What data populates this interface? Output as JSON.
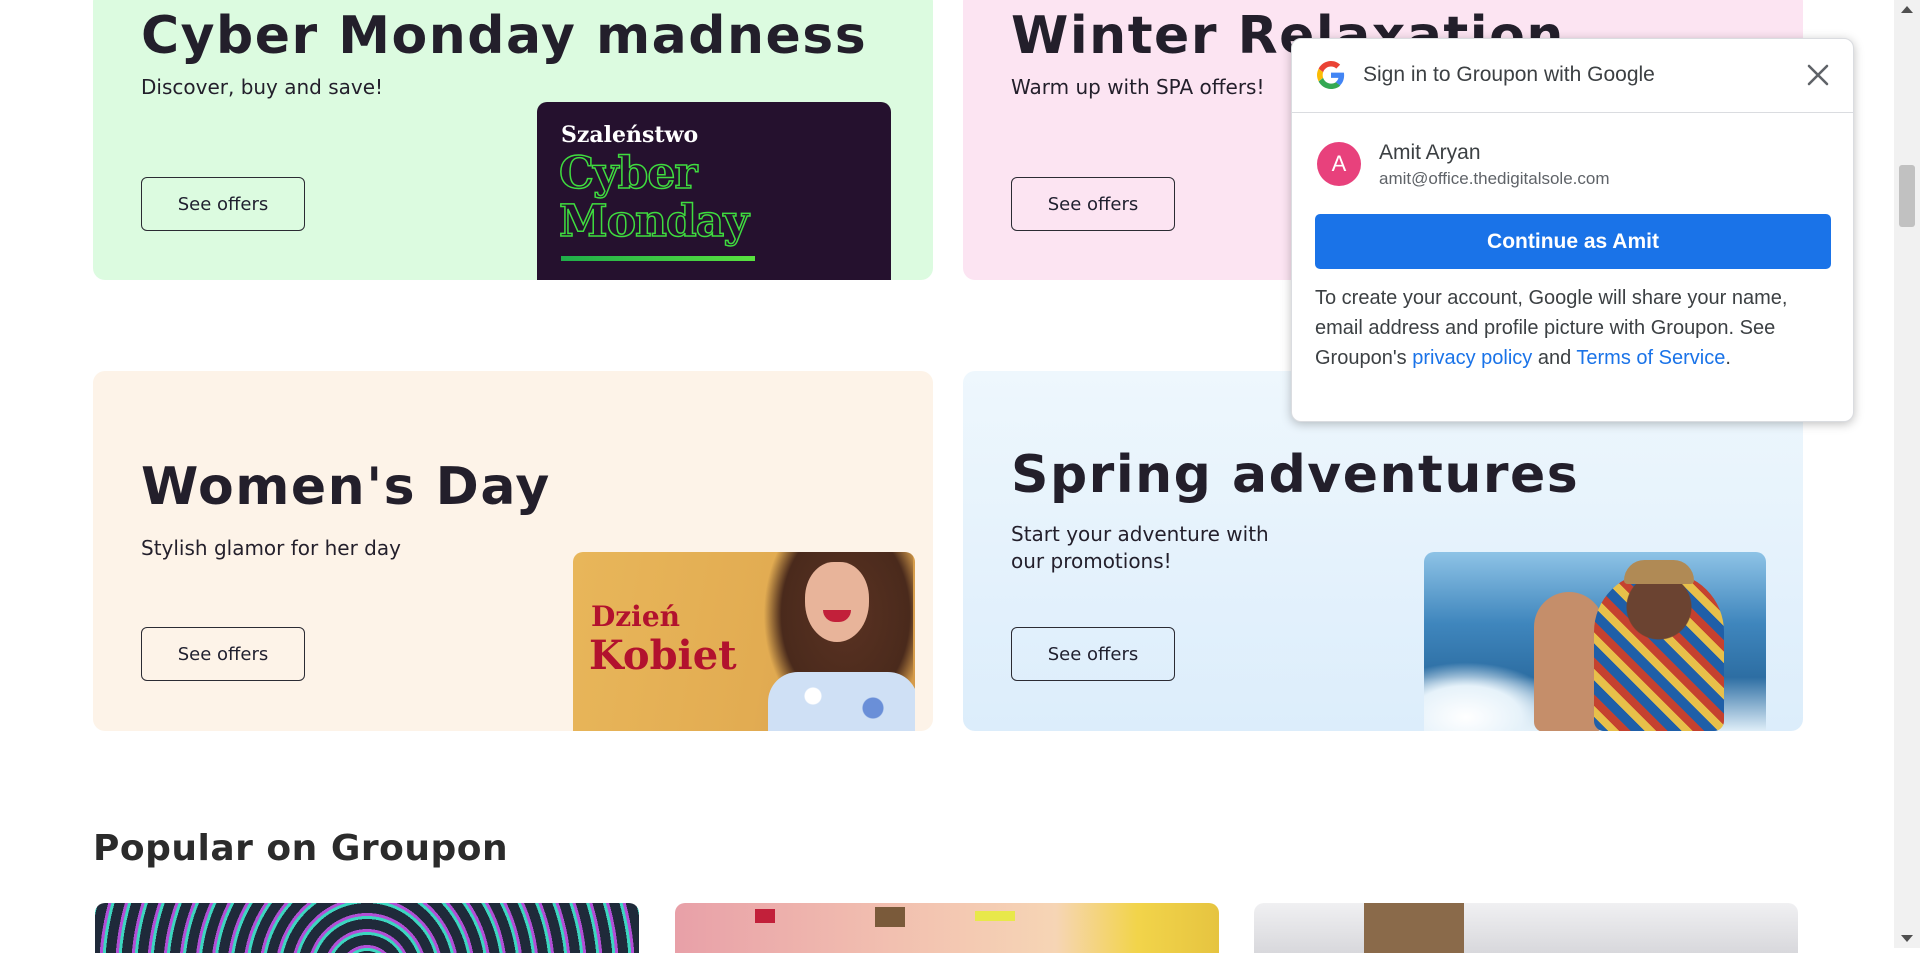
{
  "cards": [
    {
      "title": "Cyber Monday madness",
      "subtitle": "Discover, buy and save!",
      "button": "See offers"
    },
    {
      "title": "Winter Relaxation",
      "subtitle": "Warm up with SPA offers!",
      "button": "See offers"
    },
    {
      "title": "Women's Day",
      "subtitle": "Stylish glamor for her day",
      "button": "See offers"
    },
    {
      "title": "Spring adventures",
      "subtitle": "Start your adventure with our promotions!",
      "button": "See offers"
    }
  ],
  "promo_texts": {
    "cyber_line1": "Szaleństwo",
    "cyber_line2": "Cyber",
    "cyber_line3": "Monday",
    "women_line1": "Dzień",
    "women_line2": "Kobiet"
  },
  "google_popup": {
    "title": "Sign in to Groupon with Google",
    "avatar_letter": "A",
    "name": "Amit Aryan",
    "email": "amit@office.thedigitalsole.com",
    "continue_label": "Continue as Amit",
    "text_before": "To create your account, Google will share your name, email address and profile picture with Groupon. See Groupon's ",
    "privacy_link": "privacy policy",
    "text_and": " and ",
    "terms_link": "Terms of Service",
    "text_end": "."
  },
  "section": {
    "title": "Popular on Groupon"
  },
  "colors": {
    "card_green": "#dcfbe0",
    "card_pink": "#fce4f2",
    "card_peach": "#fdf3e8",
    "card_blue": "#e4f2fc",
    "google_blue": "#1a73e8"
  }
}
